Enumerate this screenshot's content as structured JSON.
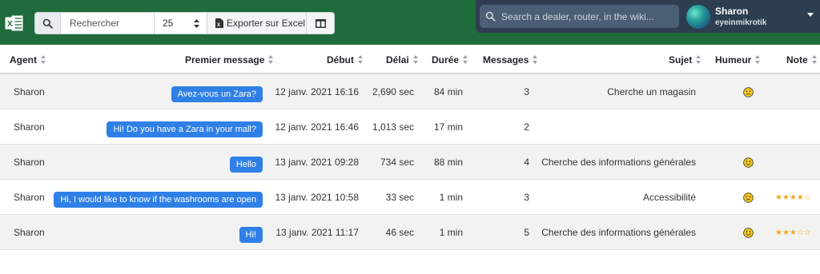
{
  "toolbar": {
    "search_placeholder": "Rechercher",
    "page_size": "25",
    "export_label": "Exporter sur Excel"
  },
  "wiki_search": {
    "placeholder": "Search a dealer, router, in the wiki..."
  },
  "user": {
    "name": "Sharon",
    "handle": "eyeinmikrotik"
  },
  "columns": {
    "agent": "Agent",
    "first_message": "Premier message",
    "start": "Début",
    "delay": "Délai",
    "duration": "Durée",
    "messages": "Messages",
    "subject": "Sujet",
    "mood": "Humeur",
    "rating": "Note"
  },
  "rows": [
    {
      "agent": "Sharon",
      "first_message": "Avez-vous un Zara?",
      "start": "12 janv. 2021 16:16",
      "delay": "2,690 sec",
      "duration": "84 min",
      "messages": "3",
      "subject": "Cherche un magasin",
      "mood": "neutral",
      "rating": ""
    },
    {
      "agent": "Sharon",
      "first_message": "Hi! Do you have a Zara in your mall?",
      "start": "12 janv. 2021 16:46",
      "delay": "1,013 sec",
      "duration": "17 min",
      "messages": "2",
      "subject": "",
      "mood": "",
      "rating": ""
    },
    {
      "agent": "Sharon",
      "first_message": "Hello",
      "start": "13 janv. 2021 09:28",
      "delay": "734 sec",
      "duration": "88 min",
      "messages": "4",
      "subject": "Cherche des informations générales",
      "mood": "happy",
      "rating": ""
    },
    {
      "agent": "Sharon",
      "first_message": "Hi, I would like to know if the washrooms are open",
      "start": "13 janv. 2021 10:58",
      "delay": "33 sec",
      "duration": "1 min",
      "messages": "3",
      "subject": "Accessibilité",
      "mood": "crying",
      "rating": "★★★★☆"
    },
    {
      "agent": "Sharon",
      "first_message": "Hi!",
      "start": "13 janv. 2021 11:17",
      "delay": "46 sec",
      "duration": "1 min",
      "messages": "5",
      "subject": "Cherche des informations générales",
      "mood": "happy",
      "rating": "★★★☆☆"
    }
  ],
  "ratings_value": [
    null,
    null,
    null,
    4,
    3
  ],
  "colors": {
    "header_green": "#1f6b3b",
    "dark_panel": "#2c3e50",
    "bubble_blue": "#2f80e6",
    "star_gold": "#f0a81e",
    "emoji_yellow": "#f5c518"
  },
  "icons": {
    "excel": "excel-logo",
    "search": "search-icon",
    "columns": "columns-icon",
    "export": "file-excel-icon",
    "caret": "caret-down-icon"
  }
}
